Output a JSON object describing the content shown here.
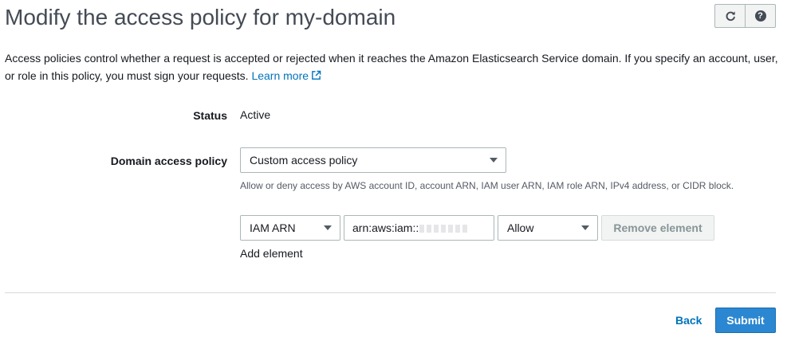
{
  "header": {
    "title": "Modify the access policy for my-domain",
    "refresh_icon": "refresh-icon",
    "help_icon": "help-icon",
    "help_glyph": "?"
  },
  "description": {
    "text": "Access policies control whether a request is accepted or rejected when it reaches the Amazon Elasticsearch Service domain. If you specify an account, user, or role in this policy, you must sign your requests.",
    "link_label": "Learn more",
    "link_icon": "external-link-icon"
  },
  "status": {
    "label": "Status",
    "value": "Active"
  },
  "domain_access_policy": {
    "label": "Domain access policy",
    "selected": "Custom access policy",
    "hint": "Allow or deny access by AWS account ID, account ARN, IAM user ARN, IAM role ARN, IPv4 address, or CIDR block."
  },
  "policy_element": {
    "type_selected": "IAM ARN",
    "arn_value": "arn:aws:iam::",
    "effect_selected": "Allow",
    "remove_label": "Remove element",
    "add_label": "Add element"
  },
  "footer": {
    "back_label": "Back",
    "submit_label": "Submit"
  },
  "colors": {
    "link": "#0073bb",
    "primary_button": "#2b87d1",
    "title": "#444b55",
    "border": "#aab7b8"
  }
}
